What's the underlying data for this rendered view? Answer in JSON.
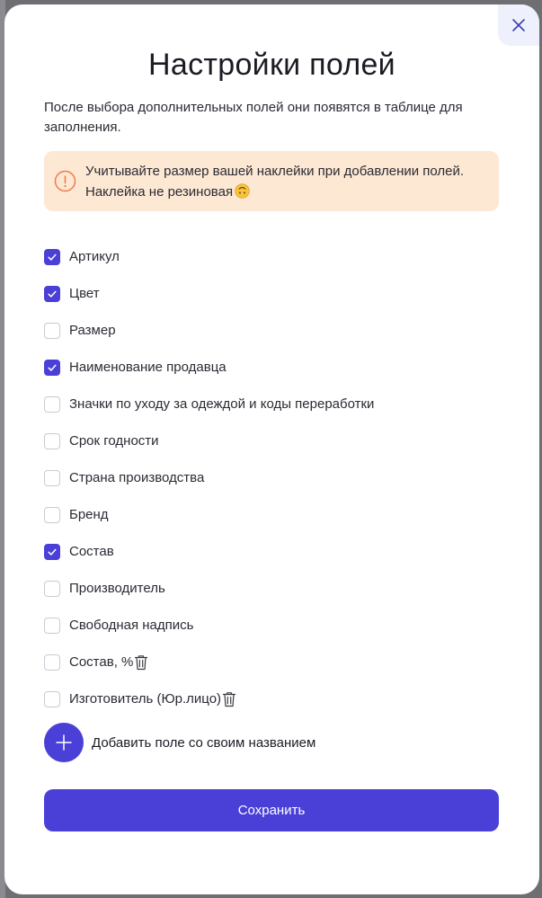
{
  "modal": {
    "title": "Настройки полей",
    "description": "После выбора дополнительных полей они появятся в таблице для заполнения.",
    "warning_text": "Учитывайте размер вашей наклейки при добавлении полей. Наклейка не резиновая",
    "warning_emoji": "upside-down-face-emoji",
    "close_icon": "close-icon"
  },
  "fields": [
    {
      "label": "Артикул",
      "checked": true,
      "deletable": false
    },
    {
      "label": "Цвет",
      "checked": true,
      "deletable": false
    },
    {
      "label": "Размер",
      "checked": false,
      "deletable": false
    },
    {
      "label": "Наименование продавца",
      "checked": true,
      "deletable": false
    },
    {
      "label": "Значки по уходу за одеждой и коды переработки",
      "checked": false,
      "deletable": false
    },
    {
      "label": "Срок годности",
      "checked": false,
      "deletable": false
    },
    {
      "label": "Страна производства",
      "checked": false,
      "deletable": false
    },
    {
      "label": "Бренд",
      "checked": false,
      "deletable": false
    },
    {
      "label": "Состав",
      "checked": true,
      "deletable": false
    },
    {
      "label": "Производитель",
      "checked": false,
      "deletable": false
    },
    {
      "label": "Свободная надпись",
      "checked": false,
      "deletable": false
    },
    {
      "label": "Состав, %",
      "checked": false,
      "deletable": true
    },
    {
      "label": "Изготовитель (Юр.лицо)",
      "checked": false,
      "deletable": true
    }
  ],
  "add_field": {
    "label": "Добавить поле со своим названием",
    "icon": "plus-icon"
  },
  "save_button": {
    "label": "Сохранить"
  },
  "colors": {
    "accent": "#4a40d8",
    "warning_bg": "#fde8d3",
    "warning_icon": "#f07a4a",
    "close_bg": "#eef1fb"
  }
}
